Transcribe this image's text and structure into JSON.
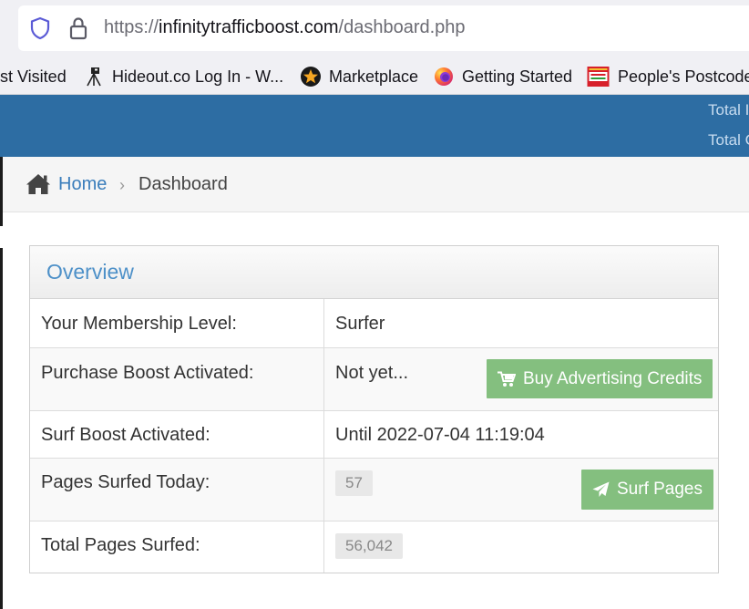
{
  "browser": {
    "url_scheme": "https://",
    "url_host": "infinitytrafficboost.com",
    "url_path": "/dashboard.php"
  },
  "bookmarks": [
    {
      "label": "st Visited",
      "icon": "none"
    },
    {
      "label": "Hideout.co Log In - W...",
      "icon": "telescope-icon"
    },
    {
      "label": "Marketplace",
      "icon": "star-badge-icon"
    },
    {
      "label": "Getting Started",
      "icon": "firefox-icon"
    },
    {
      "label": "People's Postcode ...",
      "icon": "postcode-lottery-icon"
    }
  ],
  "header": {
    "line1": "Total I",
    "line2": "Total C"
  },
  "breadcrumb": {
    "home": "Home",
    "separator": "›",
    "current": "Dashboard"
  },
  "panel": {
    "title": "Overview",
    "rows": [
      {
        "label": "Your Membership Level:",
        "value": "Surfer"
      },
      {
        "label": "Purchase Boost Activated:",
        "value": "Not yet...",
        "button": "Buy Advertising Credits"
      },
      {
        "label": "Surf Boost Activated:",
        "value": "Until 2022-07-04 11:19:04"
      },
      {
        "label": "Pages Surfed Today:",
        "value": "57",
        "button": "Surf Pages"
      },
      {
        "label": "Total Pages Surfed:",
        "value": "56,042"
      }
    ]
  },
  "colors": {
    "header_bg": "#2d6da3",
    "link": "#3a7dbb",
    "panel_title": "#4d90c8",
    "button_green": "#84bf7f"
  }
}
